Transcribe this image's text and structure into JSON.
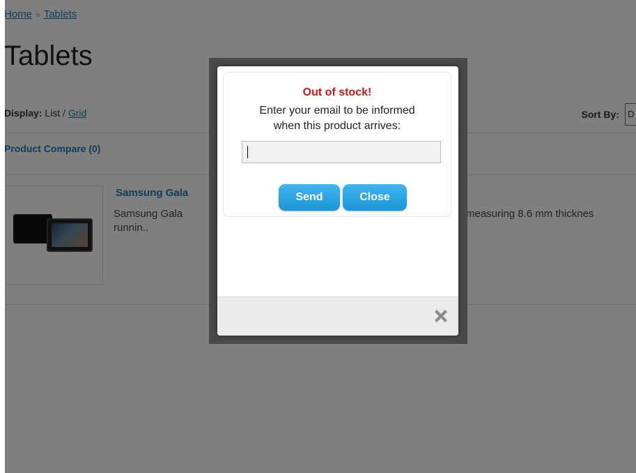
{
  "breadcrumb": {
    "home": "Home",
    "separator": "»",
    "current": "Tablets"
  },
  "page_title": "Tablets",
  "display": {
    "label": "Display:",
    "list": "List",
    "slash": "/",
    "grid": "Grid"
  },
  "sort": {
    "label": "Sort By:",
    "value": "D"
  },
  "compare": "Product Compare (0)",
  "product": {
    "name": "Samsung Gala",
    "desc_left": "Samsung Gala",
    "desc_right": "measuring 8.6 mm thicknes",
    "desc_line2": "runnin.."
  },
  "modal": {
    "title": "Out of stock!",
    "message_line1": "Enter your email to be informed",
    "message_line2": "when this product arrives:",
    "email_value": "",
    "send_label": "Send",
    "close_label": "Close",
    "close_icon": "close-x-icon"
  },
  "colors": {
    "link": "#1a7db6",
    "alert": "#d01414",
    "button": "#1c95d6"
  }
}
